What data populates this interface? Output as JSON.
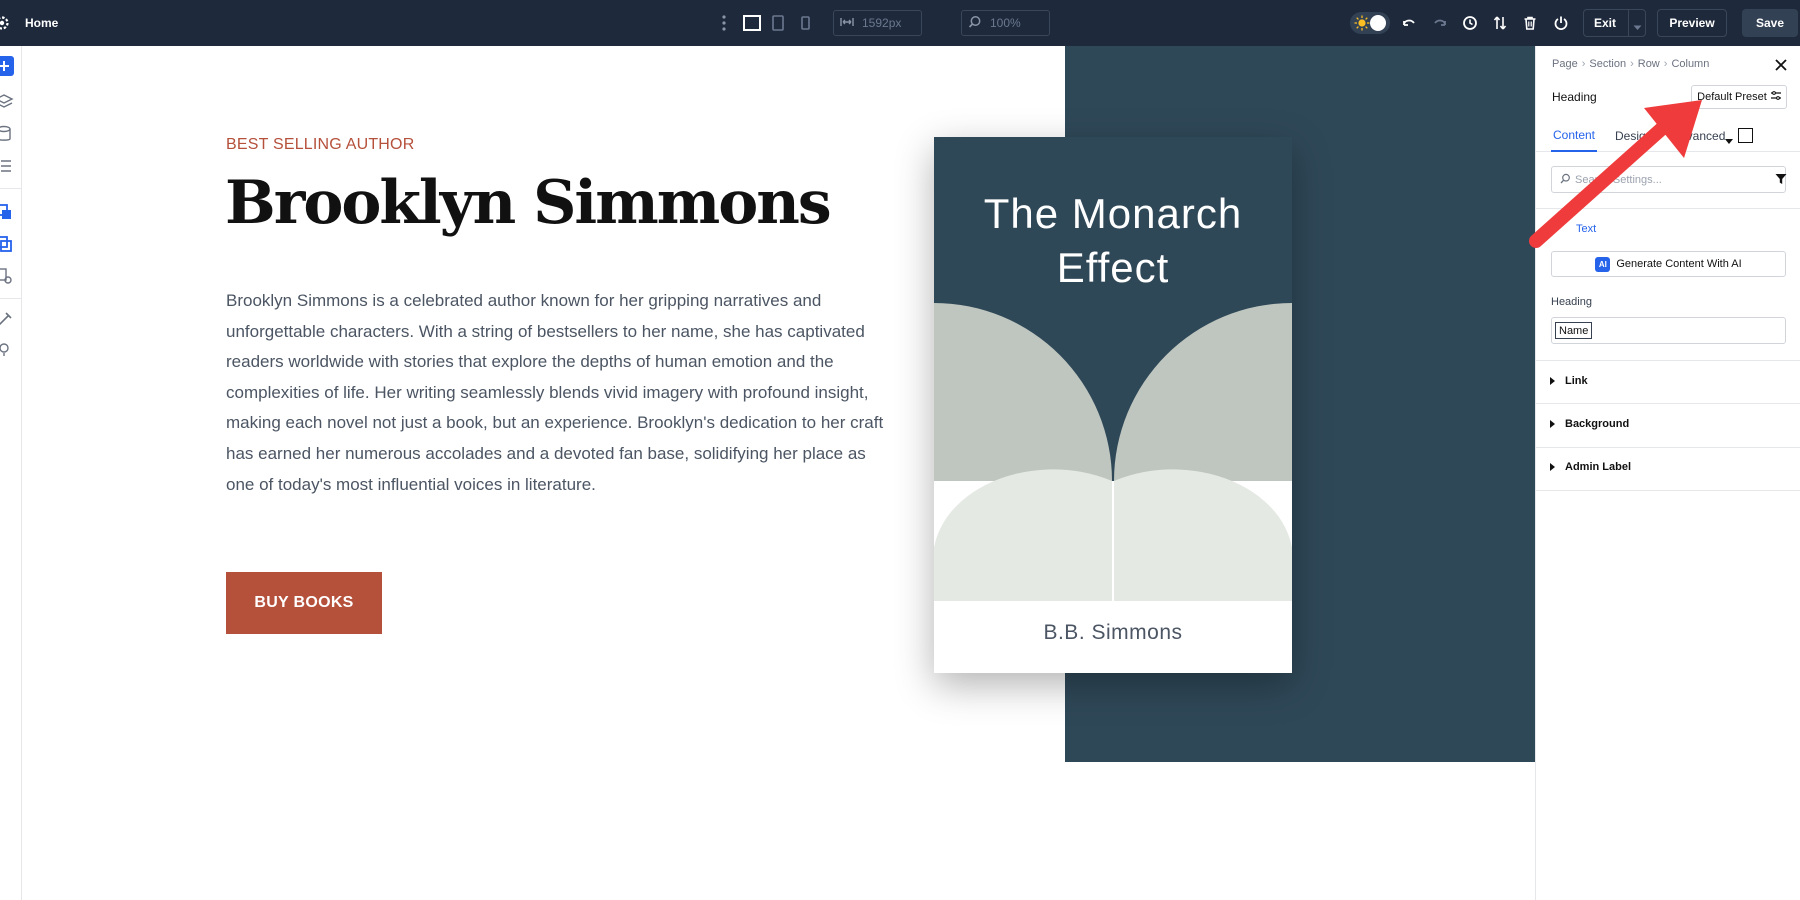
{
  "topbar": {
    "page_label": "Home",
    "width_value": "1592px",
    "zoom_value": "100%",
    "exit_label": "Exit",
    "preview_label": "Preview",
    "save_label": "Save",
    "icons": [
      "gear-icon",
      "more-vertical-icon",
      "desktop-icon",
      "tablet-icon",
      "phone-icon",
      "width-icon",
      "zoom-icon",
      "sun-icon",
      "undo-icon",
      "redo-icon",
      "history-icon",
      "sort-icon",
      "trash-icon",
      "power-icon",
      "chevron-down-icon"
    ]
  },
  "leftbar": {
    "icons": [
      "plus-icon",
      "layers-icon",
      "database-icon",
      "list-icon",
      "modules-icon",
      "copy-icon",
      "search-page-icon",
      "tools-icon",
      "help-icon"
    ]
  },
  "hero": {
    "eyebrow": "BEST SELLING AUTHOR",
    "name": "Brooklyn Simmons",
    "bio": "Brooklyn Simmons is a celebrated author known for her gripping narratives and unforgettable characters. With a string of bestsellers to her name, she has captivated readers worldwide with stories that explore the depths of human emotion and the complexities of life. Her writing seamlessly blends vivid imagery with profound insight, making each novel not just a book, but an experience. Brooklyn's dedication to her craft has earned her numerous accolades and a devoted fan base, solidifying her place as one of today's most influential voices in literature.",
    "button_label": "BUY BOOKS"
  },
  "book": {
    "title_line1": "The Monarch",
    "title_line2": "Effect",
    "author": "B.B. Simmons"
  },
  "panel": {
    "breadcrumbs": [
      "Page",
      "Section",
      "Row",
      "Column"
    ],
    "title": "Heading",
    "preset_label": "Default Preset",
    "tabs": [
      "Content",
      "Design",
      "Advanced"
    ],
    "search_placeholder": "Search Settings...",
    "section_text": "Text",
    "ai_badge": "AI",
    "ai_button": "Generate Content With AI",
    "heading_label": "Heading",
    "heading_chip": "Name",
    "accordions": [
      "Link",
      "Background",
      "Admin Label"
    ]
  },
  "colors": {
    "topbar": "#1e293b",
    "accent_red": "#b5503b",
    "dark_teal": "#2f4858",
    "panel_blue": "#2563eb",
    "annotation_arrow": "#ef3b3b"
  }
}
